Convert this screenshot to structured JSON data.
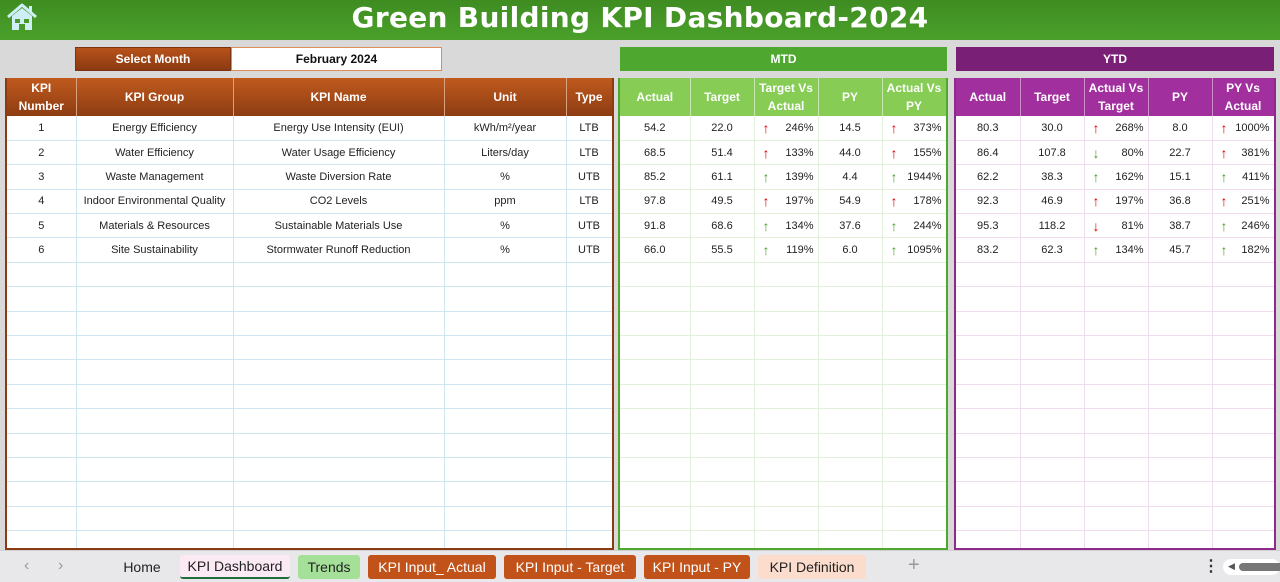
{
  "header": {
    "title": "Green Building KPI Dashboard-2024",
    "home_icon": "home-icon"
  },
  "month_selector": {
    "label": "Select Month",
    "value": "February 2024"
  },
  "sections": {
    "mtd": "MTD",
    "ytd": "YTD"
  },
  "main_table": {
    "columns": [
      "KPI Number",
      "KPI Group",
      "KPI Name",
      "Unit",
      "Type"
    ],
    "rows": [
      {
        "num": "1",
        "group": "Energy Efficiency",
        "name": "Energy Use Intensity (EUI)",
        "unit": "kWh/m²/year",
        "type": "LTB"
      },
      {
        "num": "2",
        "group": "Water Efficiency",
        "name": "Water Usage Efficiency",
        "unit": "Liters/day",
        "type": "LTB"
      },
      {
        "num": "3",
        "group": "Waste Management",
        "name": "Waste Diversion Rate",
        "unit": "%",
        "type": "UTB"
      },
      {
        "num": "4",
        "group": "Indoor Environmental Quality",
        "name": "CO2 Levels",
        "unit": "ppm",
        "type": "LTB"
      },
      {
        "num": "5",
        "group": "Materials & Resources",
        "name": "Sustainable Materials Use",
        "unit": "%",
        "type": "UTB"
      },
      {
        "num": "6",
        "group": "Site Sustainability",
        "name": "Stormwater Runoff Reduction",
        "unit": "%",
        "type": "UTB"
      }
    ]
  },
  "mtd_table": {
    "columns": [
      "Actual",
      "Target",
      "Target Vs Actual",
      "PY",
      "Actual Vs PY"
    ],
    "rows": [
      {
        "actual": "54.2",
        "target": "22.0",
        "tva": "246%",
        "tva_arrow": "up",
        "tva_color": "red",
        "py": "14.5",
        "avp": "373%",
        "avp_arrow": "up",
        "avp_color": "red"
      },
      {
        "actual": "68.5",
        "target": "51.4",
        "tva": "133%",
        "tva_arrow": "up",
        "tva_color": "red",
        "py": "44.0",
        "avp": "155%",
        "avp_arrow": "up",
        "avp_color": "red"
      },
      {
        "actual": "85.2",
        "target": "61.1",
        "tva": "139%",
        "tva_arrow": "up",
        "tva_color": "green",
        "py": "4.4",
        "avp": "1944%",
        "avp_arrow": "up",
        "avp_color": "green"
      },
      {
        "actual": "97.8",
        "target": "49.5",
        "tva": "197%",
        "tva_arrow": "up",
        "tva_color": "red",
        "py": "54.9",
        "avp": "178%",
        "avp_arrow": "up",
        "avp_color": "red"
      },
      {
        "actual": "91.8",
        "target": "68.6",
        "tva": "134%",
        "tva_arrow": "up",
        "tva_color": "green",
        "py": "37.6",
        "avp": "244%",
        "avp_arrow": "up",
        "avp_color": "green"
      },
      {
        "actual": "66.0",
        "target": "55.5",
        "tva": "119%",
        "tva_arrow": "up",
        "tva_color": "green",
        "py": "6.0",
        "avp": "1095%",
        "avp_arrow": "up",
        "avp_color": "green"
      }
    ]
  },
  "ytd_table": {
    "columns": [
      "Actual",
      "Target",
      "Actual Vs Target",
      "PY",
      "PY Vs Actual"
    ],
    "rows": [
      {
        "actual": "80.3",
        "target": "30.0",
        "tva": "268%",
        "tva_arrow": "up",
        "tva_color": "red",
        "py": "8.0",
        "avp": "1000%",
        "avp_arrow": "up",
        "avp_color": "red"
      },
      {
        "actual": "86.4",
        "target": "107.8",
        "tva": "80%",
        "tva_arrow": "down",
        "tva_color": "green",
        "py": "22.7",
        "avp": "381%",
        "avp_arrow": "up",
        "avp_color": "red"
      },
      {
        "actual": "62.2",
        "target": "38.3",
        "tva": "162%",
        "tva_arrow": "up",
        "tva_color": "green",
        "py": "15.1",
        "avp": "411%",
        "avp_arrow": "up",
        "avp_color": "green"
      },
      {
        "actual": "92.3",
        "target": "46.9",
        "tva": "197%",
        "tva_arrow": "up",
        "tva_color": "red",
        "py": "36.8",
        "avp": "251%",
        "avp_arrow": "up",
        "avp_color": "red"
      },
      {
        "actual": "95.3",
        "target": "118.2",
        "tva": "81%",
        "tva_arrow": "down",
        "tva_color": "red",
        "py": "38.7",
        "avp": "246%",
        "avp_arrow": "up",
        "avp_color": "green"
      },
      {
        "actual": "83.2",
        "target": "62.3",
        "tva": "134%",
        "tva_arrow": "up",
        "tva_color": "green",
        "py": "45.7",
        "avp": "182%",
        "avp_arrow": "up",
        "avp_color": "green"
      }
    ]
  },
  "empty_rows": 12,
  "sheet_tabs": [
    {
      "label": "Home",
      "style": "plain"
    },
    {
      "label": "KPI Dashboard",
      "style": "active"
    },
    {
      "label": "Trends",
      "style": "green"
    },
    {
      "label": "KPI Input_ Actual",
      "style": "orange"
    },
    {
      "label": "KPI Input - Target",
      "style": "orange"
    },
    {
      "label": "KPI Input - PY",
      "style": "orange"
    },
    {
      "label": "KPI Definition",
      "style": "peach"
    }
  ],
  "colors": {
    "banner": "#4aa02a",
    "main_header": "#a8491a",
    "mtd_header": "#86cc55",
    "ytd_header": "#a1309e",
    "arrow_red": "#e00000",
    "arrow_green": "#4aa02a"
  }
}
